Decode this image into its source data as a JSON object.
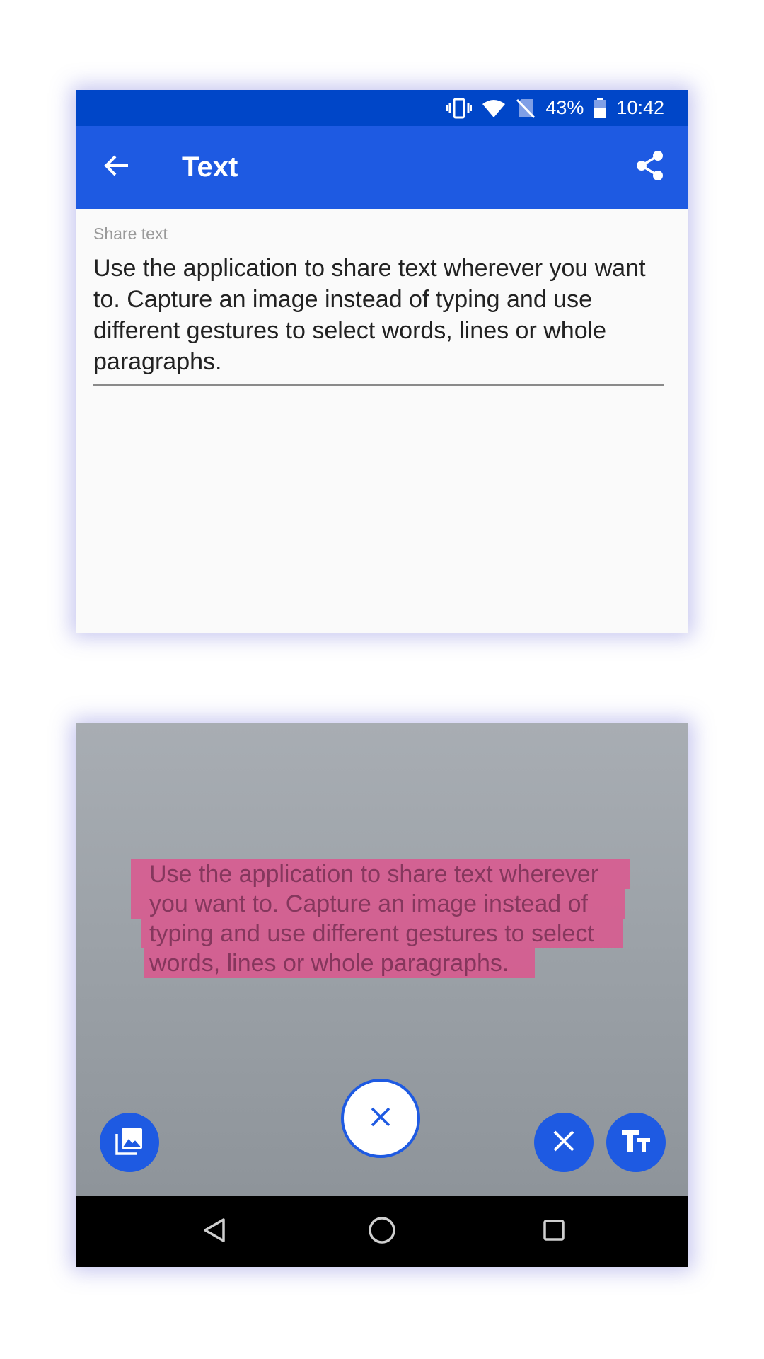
{
  "status_bar": {
    "battery_percent": "43%",
    "time": "10:42",
    "icons": [
      "vibrate-icon",
      "wifi-icon",
      "no-sim-icon",
      "battery-icon"
    ]
  },
  "app_bar": {
    "title": "Text",
    "back_icon": "arrow-back-icon",
    "share_icon": "share-icon"
  },
  "editor": {
    "label": "Share text",
    "value": "Use the application to share text wherever you want to. Capture an image instead of typing and use different gestures to select words, lines or whole paragraphs."
  },
  "camera": {
    "recognized_lines": [
      "Use the application to share text wherever",
      "you want to. Capture an image instead of",
      "typing and use different gestures to select",
      "words, lines or whole paragraphs."
    ],
    "buttons": {
      "gallery_icon": "gallery-icon",
      "capture_icon": "close-icon",
      "clear_icon": "close-icon",
      "text_mode_icon": "text-size-icon"
    }
  },
  "nav_bar": {
    "icons": [
      "nav-back-icon",
      "nav-home-icon",
      "nav-recents-icon"
    ]
  },
  "colors": {
    "status_bar": "#0046c8",
    "app_bar": "#1e5ae2",
    "highlight": "#e2508c",
    "accent": "#1e5ae2"
  }
}
